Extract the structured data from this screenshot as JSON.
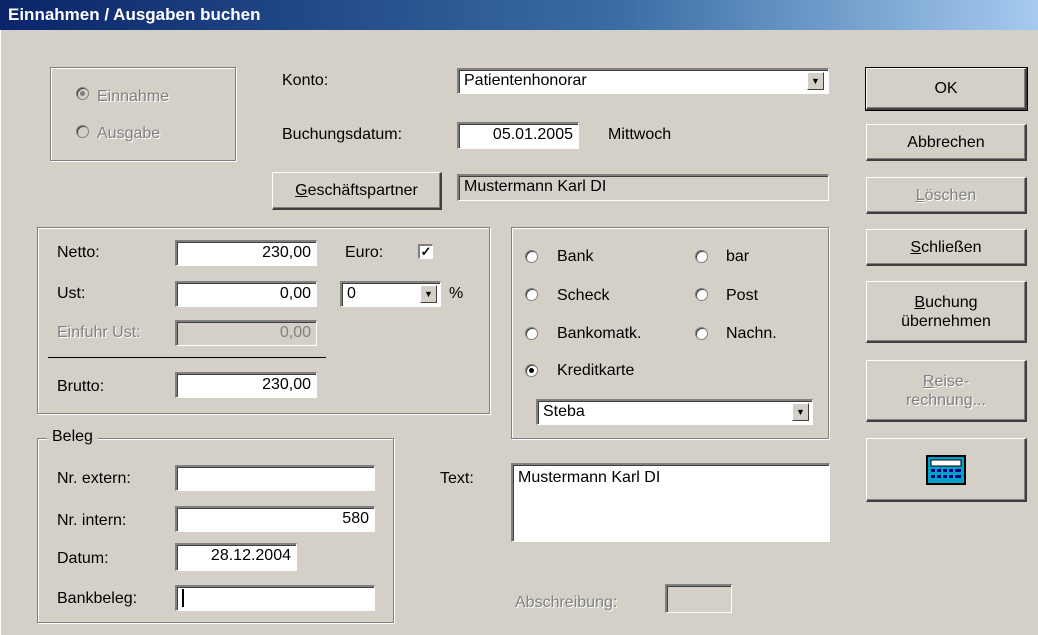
{
  "window": {
    "title": "Einnahmen / Ausgaben buchen"
  },
  "type_group": {
    "income_label": "Einnahme",
    "expense_label": "Ausgabe",
    "selected": "income"
  },
  "konto": {
    "label": "Konto:",
    "value": "Patientenhonorar"
  },
  "buchungsdatum": {
    "label": "Buchungsdatum:",
    "value": "05.01.2005",
    "weekday": "Mittwoch"
  },
  "partner": {
    "button_label": "Geschäftspartner",
    "value": "Mustermann Karl DI"
  },
  "amounts": {
    "netto_label": "Netto:",
    "netto_value": "230,00",
    "euro_label": "Euro:",
    "euro_checked": "✓",
    "ust_label": "Ust:",
    "ust_value": "0,00",
    "ust_rate": "0",
    "percent_sign": "%",
    "einfuhr_label": "Einfuhr Ust:",
    "einfuhr_value": "0,00",
    "brutto_label": "Brutto:",
    "brutto_value": "230,00"
  },
  "payment": {
    "options": [
      "Bank",
      "bar",
      "Scheck",
      "Post",
      "Bankomatk.",
      "Nachn.",
      "Kreditkarte"
    ],
    "selected": "Kreditkarte",
    "card_value": "Steba"
  },
  "beleg": {
    "legend": "Beleg",
    "extern_label": "Nr. extern:",
    "extern_value": "",
    "intern_label": "Nr. intern:",
    "intern_value": "580",
    "datum_label": "Datum:",
    "datum_value": "28.12.2004",
    "bankbeleg_label": "Bankbeleg:",
    "bankbeleg_value": ""
  },
  "text": {
    "label": "Text:",
    "value": "Mustermann Karl DI"
  },
  "abschreibung": {
    "label": "Abschreibung:",
    "value": ""
  },
  "buttons": {
    "ok": "OK",
    "abbrechen": "Abbrechen",
    "loeschen": "Löschen",
    "schliessen": "Schließen",
    "buchung_line1": "Buchung",
    "buchung_line2": "übernehmen",
    "reise_line1": "Reise-",
    "reise_line2": "rechnung...",
    "calculator_icon": "calculator-icon"
  },
  "colors": {
    "titlebar_start": "#0a246a",
    "titlebar_end": "#a6caf0",
    "dialog_bg": "#d4d0c8"
  }
}
